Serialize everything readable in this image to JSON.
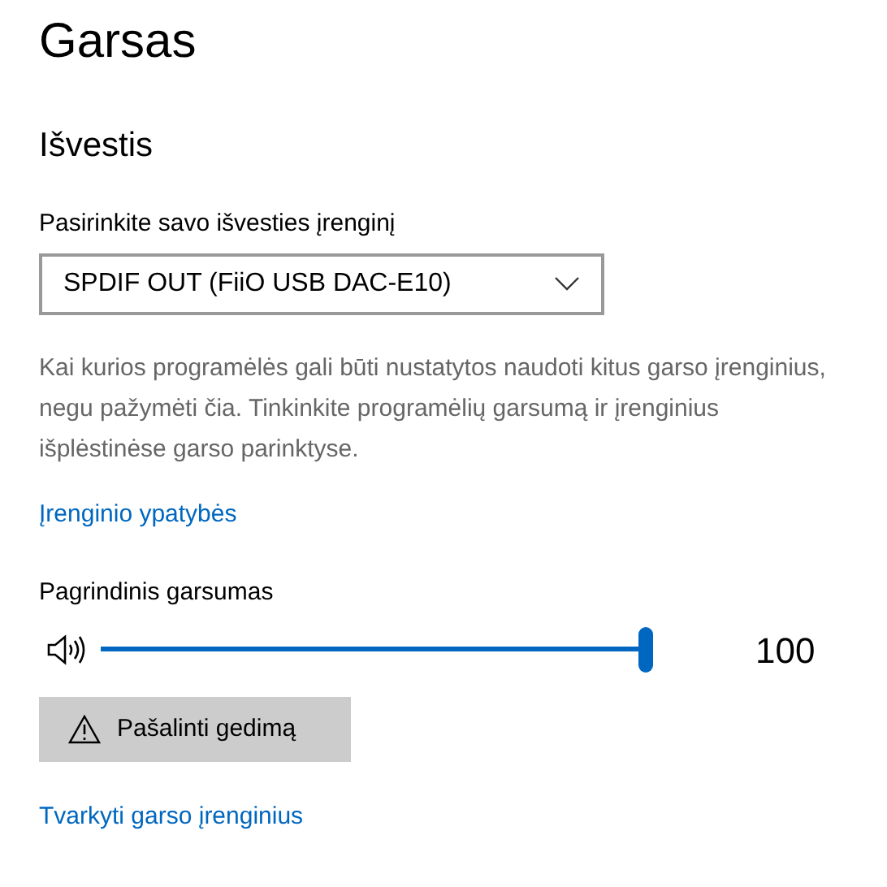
{
  "page_title": "Garsas",
  "section_title": "Išvestis",
  "output_device": {
    "label": "Pasirinkite savo išvesties įrenginį",
    "value": "SPDIF OUT (FiiO USB DAC-E10)"
  },
  "description": "Kai kurios programėlės gali būti nustatytos naudoti kitus garso įrenginius, negu pažymėti čia. Tinkinkite programėlių garsumą ir įrenginius išplėstinėse garso parinktyse.",
  "device_properties_link": "Įrenginio ypatybės",
  "master_volume": {
    "label": "Pagrindinis garsumas",
    "level": 1.0,
    "reading": "100"
  },
  "troubleshoot_button": "Pašalinti gedimą",
  "manage_devices_link": "Tvarkyti garso įrenginius"
}
